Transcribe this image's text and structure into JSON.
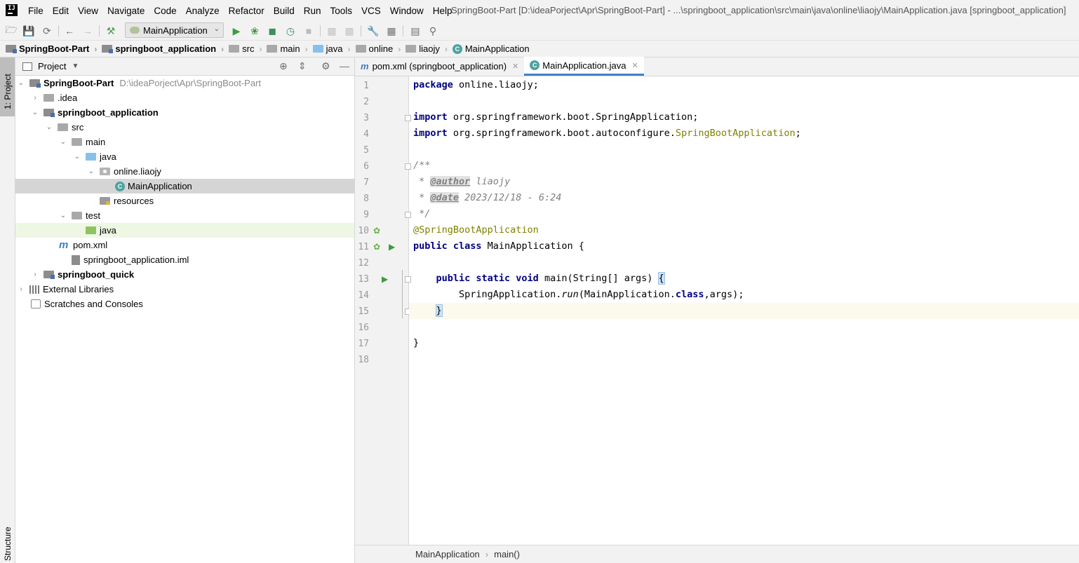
{
  "menu": {
    "items": [
      "File",
      "Edit",
      "View",
      "Navigate",
      "Code",
      "Analyze",
      "Refactor",
      "Build",
      "Run",
      "Tools",
      "VCS",
      "Window",
      "Help"
    ],
    "window_title": "SpringBoot-Part [D:\\ideaPorject\\Apr\\SpringBoot-Part] - ...\\springboot_application\\src\\main\\java\\online\\liaojy\\MainApplication.java [springboot_application]"
  },
  "toolbar": {
    "run_config": "MainApplication"
  },
  "navbar": {
    "crumbs": [
      "SpringBoot-Part",
      "springboot_application",
      "src",
      "main",
      "java",
      "online",
      "liaojy",
      "MainApplication"
    ]
  },
  "side_tabs": {
    "project": "1: Project",
    "structure": "Structure"
  },
  "project": {
    "header": "Project",
    "tree": [
      {
        "label": "SpringBoot-Part",
        "path": "D:\\ideaPorject\\Apr\\SpringBoot-Part"
      },
      {
        "label": ".idea"
      },
      {
        "label": "springboot_application"
      },
      {
        "label": "src"
      },
      {
        "label": "main"
      },
      {
        "label": "java"
      },
      {
        "label": "online.liaojy"
      },
      {
        "label": "MainApplication"
      },
      {
        "label": "resources"
      },
      {
        "label": "test"
      },
      {
        "label": "java"
      },
      {
        "label": "pom.xml"
      },
      {
        "label": "springboot_application.iml"
      },
      {
        "label": "springboot_quick"
      },
      {
        "label": "External Libraries"
      },
      {
        "label": "Scratches and Consoles"
      }
    ]
  },
  "editor": {
    "tabs": [
      {
        "label": "pom.xml (springboot_application)",
        "icon_letter": "m"
      },
      {
        "label": "MainApplication.java",
        "icon_letter": "C"
      }
    ],
    "line_numbers": [
      "1",
      "2",
      "3",
      "4",
      "5",
      "6",
      "7",
      "8",
      "9",
      "10",
      "11",
      "12",
      "13",
      "14",
      "15",
      "16",
      "17",
      "18"
    ],
    "code": {
      "l1_kw": "package",
      "l1_rest": " online.liaojy;",
      "l3_kw": "import",
      "l3_rest": " org.springframework.boot.SpringApplication;",
      "l4_kw": "import",
      "l4_rest": " org.springframework.boot.autoconfigure.",
      "l4_ann": "SpringBootApplication",
      "l4_end": ";",
      "l6": "/**",
      "l7_pre": " * ",
      "l7_tag": "@author",
      "l7_val": " liaojy",
      "l8_pre": " * ",
      "l8_tag": "@date",
      "l8_val": " 2023/12/18 - 6:24",
      "l9": " */",
      "l10": "@SpringBootApplication",
      "l11_kw": "public class",
      "l11_rest": " MainApplication {",
      "l13_indent": "    ",
      "l13_kw": "public static void",
      "l13_rest": " main(String[] args) ",
      "l13_brace": "{",
      "l14_indent": "        ",
      "l14_a": "SpringApplication.",
      "l14_run": "run",
      "l14_b": "(MainApplication.",
      "l14_kw": "class",
      "l14_c": ",args);",
      "l15_indent": "    ",
      "l15_brace": "}",
      "l17": "}"
    },
    "breadcrumb": [
      "MainApplication",
      "main()"
    ]
  }
}
